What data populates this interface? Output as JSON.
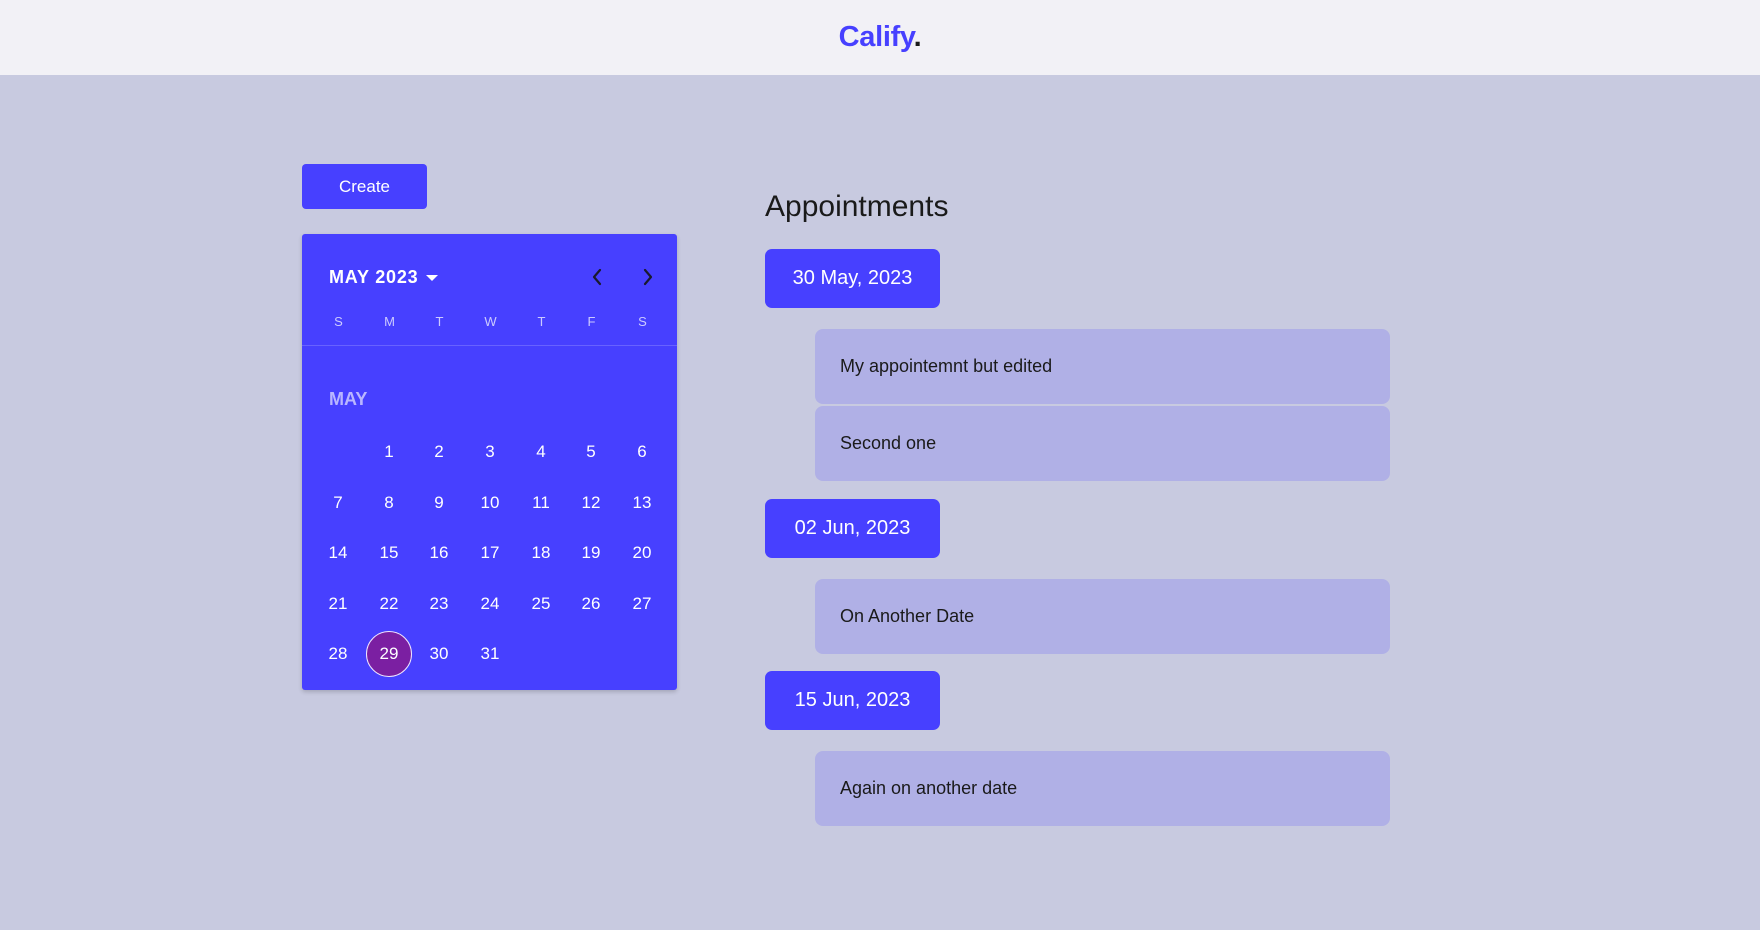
{
  "header": {
    "logo_text": "Calify",
    "logo_dot": ".",
    "accent_color": "#4740ff"
  },
  "toolbar": {
    "create_label": "Create"
  },
  "calendar": {
    "month_label": "MAY 2023",
    "dropdown_icon": "caret-down-icon",
    "prev_icon": "chevron-left-icon",
    "next_icon": "chevron-right-icon",
    "weekdays": [
      "S",
      "M",
      "T",
      "W",
      "T",
      "F",
      "S"
    ],
    "body_month": "MAY",
    "first_weekday_index": 1,
    "days": [
      "1",
      "2",
      "3",
      "4",
      "5",
      "6",
      "7",
      "8",
      "9",
      "10",
      "11",
      "12",
      "13",
      "14",
      "15",
      "16",
      "17",
      "18",
      "19",
      "20",
      "21",
      "22",
      "23",
      "24",
      "25",
      "26",
      "27",
      "28",
      "29",
      "30",
      "31"
    ],
    "selected_day": "29",
    "selected_color": "#7b1fa2"
  },
  "appointments": {
    "title": "Appointments",
    "groups": [
      {
        "date": "30 May, 2023",
        "items": [
          "My appointemnt but edited",
          "Second one"
        ]
      },
      {
        "date": "02 Jun, 2023",
        "items": [
          "On Another Date"
        ]
      },
      {
        "date": "15 Jun, 2023",
        "items": [
          "Again on another date"
        ]
      }
    ]
  }
}
